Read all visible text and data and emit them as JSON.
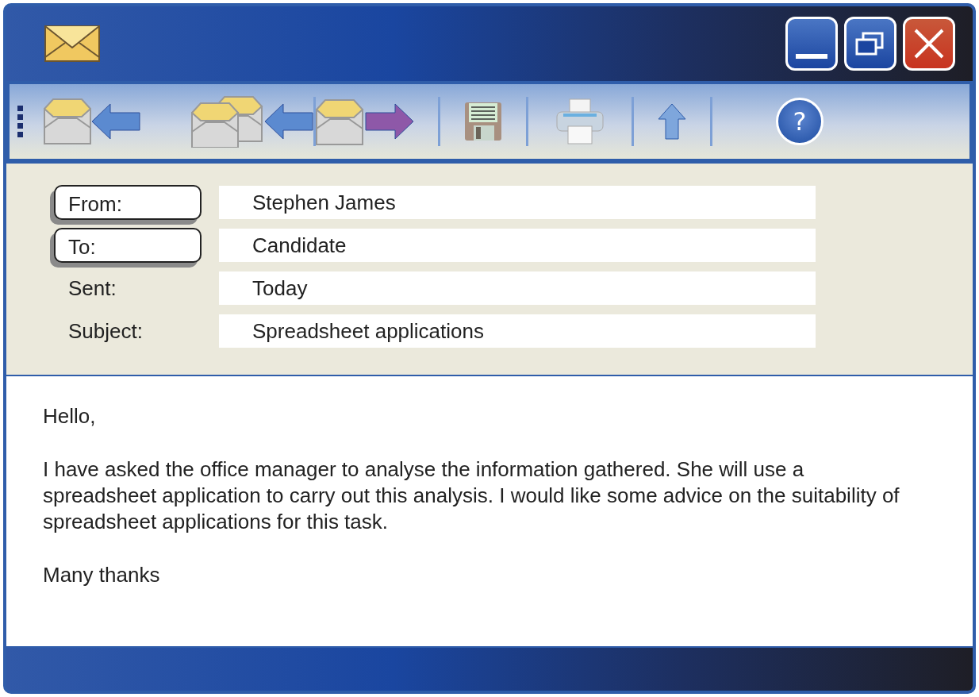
{
  "header_fields": [
    {
      "kind": "button",
      "label": "From:",
      "value": "Stephen James"
    },
    {
      "kind": "button",
      "label": "To:",
      "value": "Candidate"
    },
    {
      "kind": "plain",
      "label": "Sent:",
      "value": "Today"
    },
    {
      "kind": "plain",
      "label": "Subject:",
      "value": "Spreadsheet applications"
    }
  ],
  "toolbar": {
    "help_label": "?"
  },
  "message": [
    "Hello,",
    "I have asked the office manager to analyse the information gathered. She will use a spreadsheet application to carry out this analysis. I would like some advice on the suitability of spreadsheet applications for this task.",
    "Many thanks"
  ]
}
